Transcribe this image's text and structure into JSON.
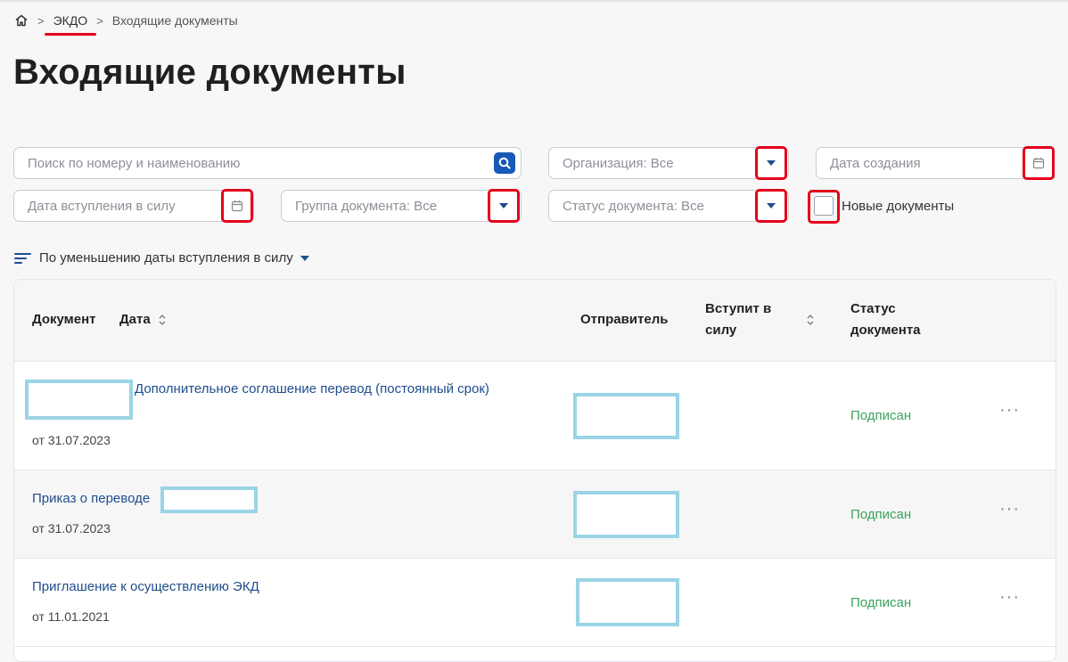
{
  "breadcrumb": {
    "home_icon": "home-icon",
    "separator": ">",
    "items": [
      "ЭКДО",
      "Входящие документы"
    ]
  },
  "page_title": "Входящие документы",
  "filters": {
    "search_placeholder": "Поиск по номеру и наименованию",
    "organization": "Организация: Все",
    "created_date_placeholder": "Дата создания",
    "effective_date_placeholder": "Дата вступления в силу",
    "doc_group": "Группа документа: Все",
    "doc_status": "Статус документа: Все",
    "new_docs_label": "Новые документы",
    "new_docs_checked": false
  },
  "sort": {
    "label": "По уменьшению даты вступления в силу"
  },
  "table": {
    "columns": {
      "document": "Документ",
      "date": "Дата",
      "sender": "Отправитель",
      "effective_line1": "Вступит в",
      "effective_line2": "силу",
      "status_line1": "Статус",
      "status_line2": "документа"
    },
    "rows": [
      {
        "title": "Дополнительное соглашение перевод (постоянный срок)",
        "date": "от 31.07.2023",
        "status": "Подписан"
      },
      {
        "title": "Приказ о переводе",
        "date": "от 31.07.2023",
        "status": "Подписан"
      },
      {
        "title": "Приглашение к осуществлению ЭКД",
        "date": "от 11.01.2021",
        "status": "Подписан"
      }
    ],
    "more_label": "···"
  },
  "colors": {
    "accent_blue": "#1858b8",
    "link_blue": "#1f4d8c",
    "status_green": "#3aa35a",
    "annotation_red": "#e3001b",
    "redaction_cyan": "#9bd4e6"
  }
}
